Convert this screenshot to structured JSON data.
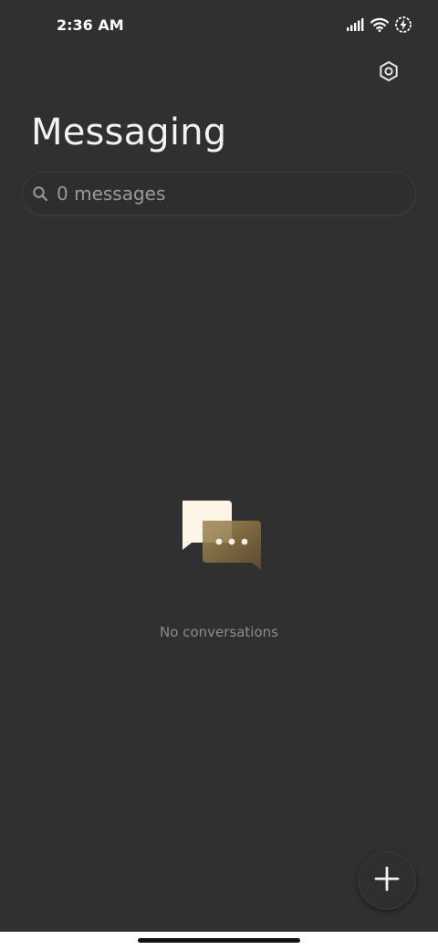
{
  "status_bar": {
    "time": "2:36 AM",
    "icons": [
      "signal-icon",
      "wifi-icon",
      "battery-charging-icon"
    ]
  },
  "header": {
    "title": "Messaging",
    "settings_icon": "settings-icon"
  },
  "search": {
    "placeholder": "0 messages",
    "icon": "search-icon"
  },
  "empty_state": {
    "message": "No conversations",
    "illustration": "chat-bubbles-icon"
  },
  "fab": {
    "icon": "plus-icon"
  },
  "colors": {
    "background": "#303030",
    "title": "#f2f2f2",
    "muted_text": "#8c8c8c",
    "bubble_light": "#fdf6e6",
    "bubble_gold": "#7a6640"
  }
}
